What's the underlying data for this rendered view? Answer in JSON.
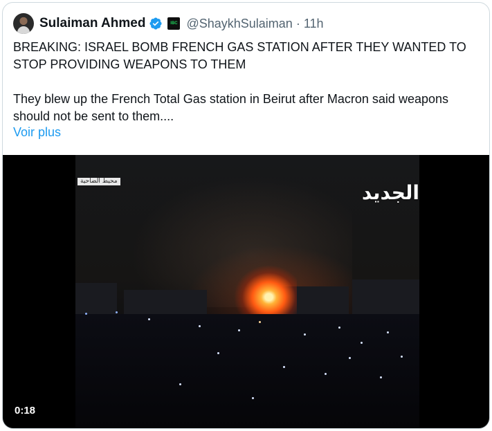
{
  "tweet": {
    "author_name": "Sulaiman Ahmed",
    "affiliate_badge_text": "IBC",
    "handle": "@ShaykhSulaiman",
    "separator": "·",
    "time": "11h",
    "text_line1": "BREAKING: ISRAEL BOMB FRENCH GAS STATION AFTER THEY WANTED TO STOP PROVIDING WEAPONS TO THEM",
    "text_line2": "They blew up the French Total Gas station in Beirut after Macron said weapons should not be sent to them....",
    "show_more": "Voir plus"
  },
  "video": {
    "location_tag": "محيط الضاحية",
    "channel_logo": "الجديد",
    "duration": "0:18"
  },
  "colors": {
    "link": "#1d9bf0",
    "verified": "#1d9bf0",
    "secondary_text": "#536471"
  },
  "icons": {
    "verified": "verified-badge-icon",
    "affiliate": "affiliate-badge-icon"
  }
}
